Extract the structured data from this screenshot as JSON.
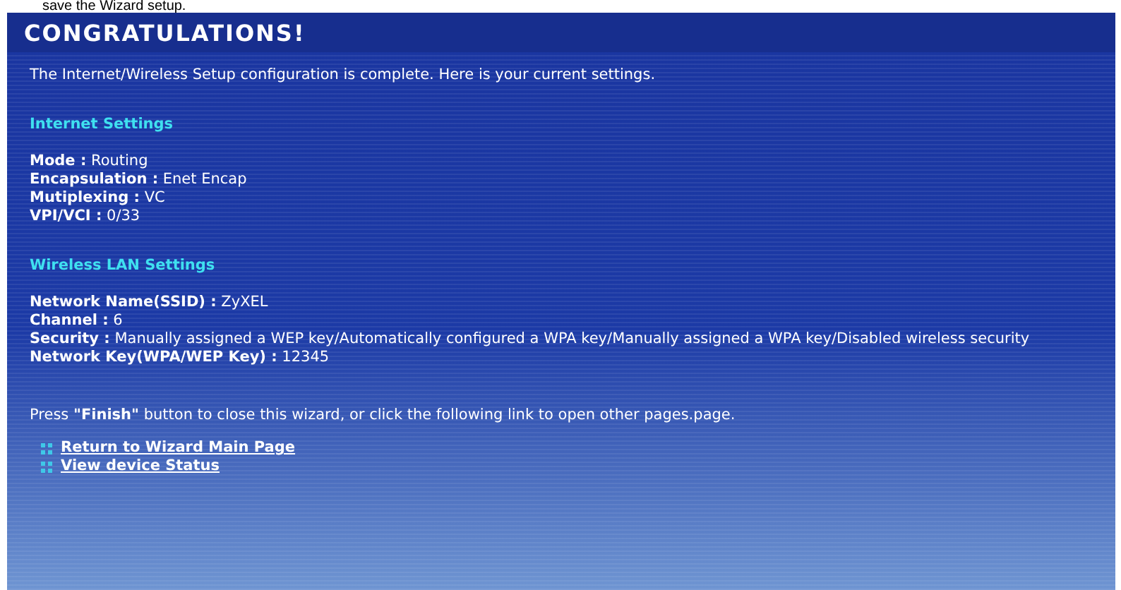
{
  "caption": "save the Wizard setup.",
  "title": "CONGRATULATIONS!",
  "intro": "The Internet/Wireless Setup configuration is complete. Here is your current settings.",
  "sections": [
    {
      "heading": "Internet Settings",
      "fields": [
        {
          "label": "Mode :",
          "value": "Routing"
        },
        {
          "label": "Encapsulation :",
          "value": "Enet Encap"
        },
        {
          "label": "Mutiplexing :",
          "value": "VC"
        },
        {
          "label": "VPI/VCI :",
          "value": "0/33"
        }
      ]
    },
    {
      "heading": "Wireless LAN Settings",
      "fields": [
        {
          "label": "Network Name(SSID) :",
          "value": "ZyXEL"
        },
        {
          "label": "Channel :",
          "value": "6"
        },
        {
          "label": "Security :",
          "value": "Manually assigned a WEP key/Automatically configured a WPA key/Manually assigned a WPA key/Disabled wireless security"
        },
        {
          "label": "Network Key(WPA/WEP Key) :",
          "value": "12345"
        }
      ]
    }
  ],
  "note": "Press **\"Finish\"** button to close this wizard, or click the following link to open other pages.page.",
  "links": [
    "Return to Wizard Main Page",
    "View device Status"
  ]
}
